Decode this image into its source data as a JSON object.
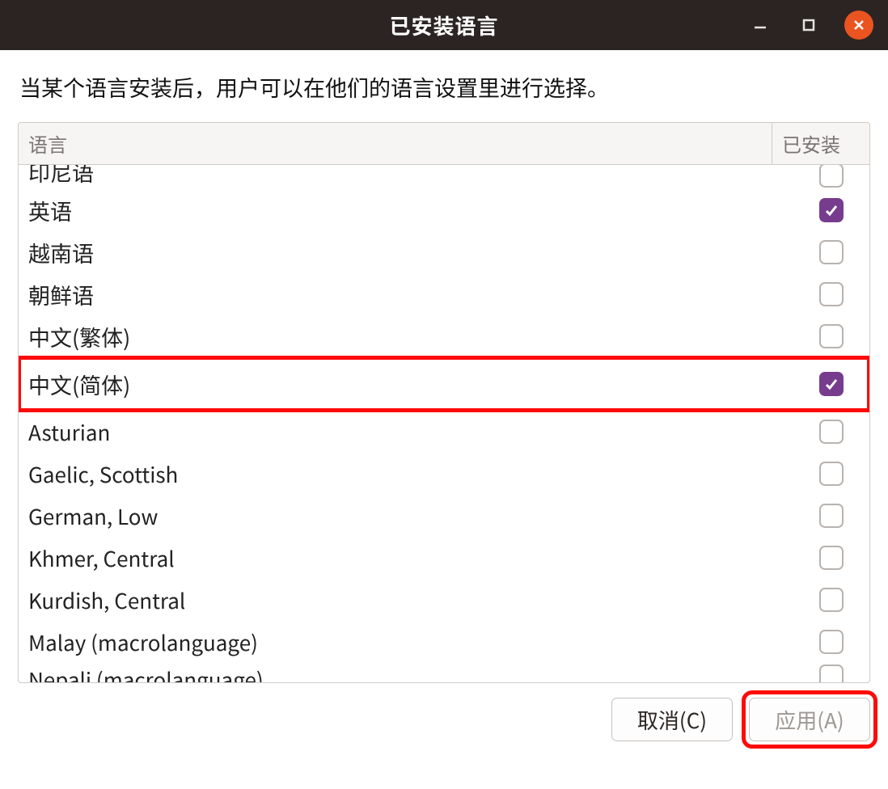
{
  "window": {
    "title": "已安装语言"
  },
  "description": "当某个语言安装后，用户可以在他们的语言设置里进行选择。",
  "columns": {
    "language": "语言",
    "installed": "已安装"
  },
  "languages": [
    {
      "label": "印尼语",
      "checked": false,
      "cjk": true,
      "partial": "top"
    },
    {
      "label": "英语",
      "checked": true,
      "cjk": true
    },
    {
      "label": "越南语",
      "checked": false,
      "cjk": true
    },
    {
      "label": "朝鲜语",
      "checked": false,
      "cjk": true
    },
    {
      "label": "中文(繁体)",
      "checked": false,
      "cjk": true
    },
    {
      "label": "中文(简体)",
      "checked": true,
      "cjk": true,
      "highlight": true
    },
    {
      "label": "Asturian",
      "checked": false
    },
    {
      "label": "Gaelic, Scottish",
      "checked": false
    },
    {
      "label": "German, Low",
      "checked": false
    },
    {
      "label": "Khmer, Central",
      "checked": false
    },
    {
      "label": "Kurdish, Central",
      "checked": false
    },
    {
      "label": "Malay (macrolanguage)",
      "checked": false
    },
    {
      "label": "Nepali (macrolanguage)",
      "checked": false,
      "partial": "bottom"
    }
  ],
  "buttons": {
    "cancel": "取消(C)",
    "apply": "应用(A)"
  },
  "colors": {
    "accent": "#773c8e",
    "close": "#e95420",
    "highlight": "#ff0a0a"
  }
}
